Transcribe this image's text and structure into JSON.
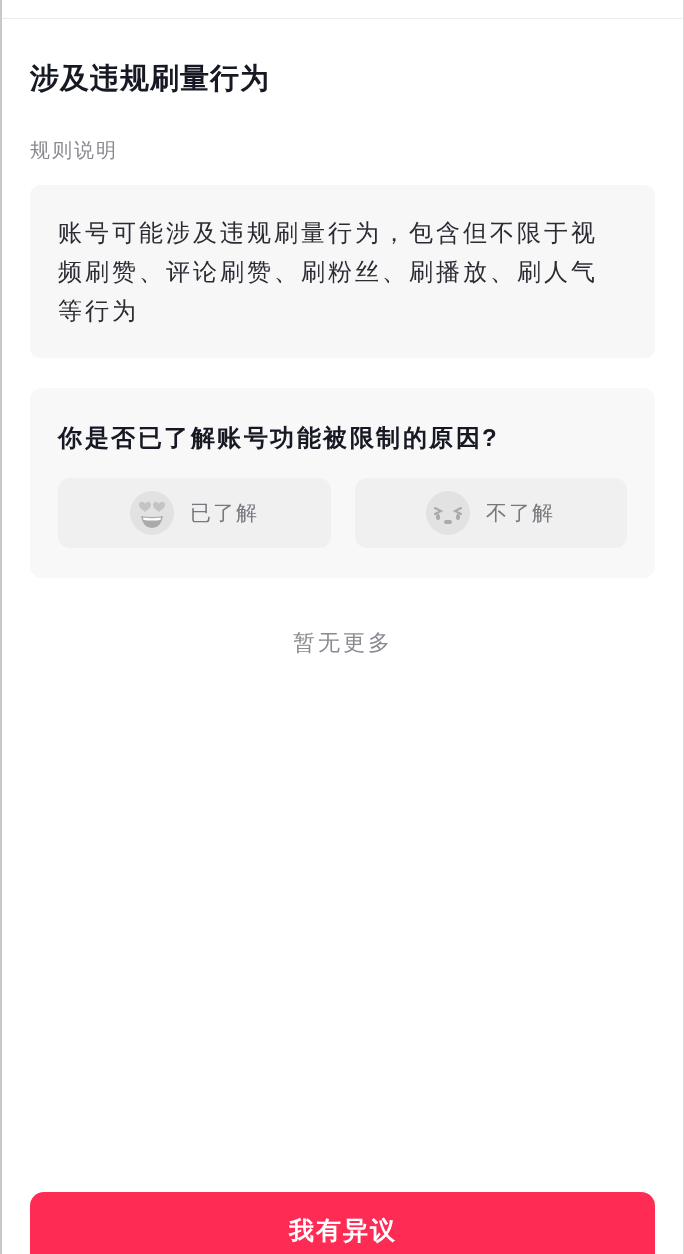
{
  "page": {
    "title": "涉及违规刷量行为",
    "section_label": "规则说明",
    "rule_text": "账号可能涉及违规刷量行为，包含但不限于视频刷赞、评论刷赞、刷粉丝、刷播放、刷人气等行为"
  },
  "survey": {
    "question": "你是否已了解账号功能被限制的原因?",
    "options": [
      {
        "label": "已了解",
        "kind": "happy",
        "selected": false
      },
      {
        "label": "不了解",
        "kind": "confused",
        "selected": false
      }
    ]
  },
  "footer_note": "暂无更多",
  "action_button": "我有异议"
}
